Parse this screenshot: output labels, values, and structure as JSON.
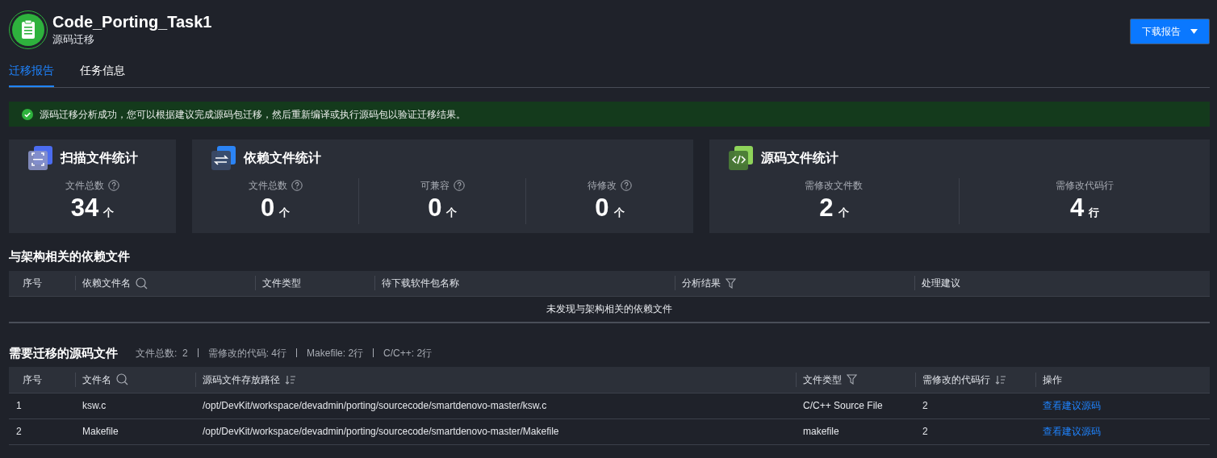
{
  "header": {
    "title": "Code_Porting_Task1",
    "subtitle": "源码迁移"
  },
  "download_button": {
    "label": "下载报告"
  },
  "tabs": [
    {
      "label": "迁移报告",
      "selected": true
    },
    {
      "label": "任务信息",
      "selected": false
    }
  ],
  "alert": {
    "message": "源码迁移分析成功，您可以根据建议完成源码包迁移，然后重新编译或执行源码包以验证迁移结果。"
  },
  "stat_cards": [
    {
      "kind": "scan",
      "title": "扫描文件统计",
      "metrics": [
        {
          "label": "文件总数",
          "help": true,
          "value": "34",
          "unit": "个"
        }
      ]
    },
    {
      "kind": "dependency",
      "title": "依赖文件统计",
      "metrics": [
        {
          "label": "文件总数",
          "help": true,
          "value": "0",
          "unit": "个"
        },
        {
          "label": "可兼容",
          "help": true,
          "value": "0",
          "unit": "个"
        },
        {
          "label": "待修改",
          "help": true,
          "value": "0",
          "unit": "个"
        }
      ]
    },
    {
      "kind": "source",
      "title": "源码文件统计",
      "metrics": [
        {
          "label": "需修改文件数",
          "help": false,
          "value": "2",
          "unit": "个"
        },
        {
          "label": "需修改代码行",
          "help": false,
          "value": "4",
          "unit": "行"
        }
      ]
    }
  ],
  "dependency_table": {
    "title": "与架构相关的依赖文件",
    "columns": [
      {
        "label": "序号",
        "kind": "plain"
      },
      {
        "label": "依赖文件名",
        "kind": "search"
      },
      {
        "label": "文件类型",
        "kind": "plain"
      },
      {
        "label": "待下载软件包名称",
        "kind": "plain"
      },
      {
        "label": "分析结果",
        "kind": "filter"
      },
      {
        "label": "处理建议",
        "kind": "plain"
      }
    ],
    "empty_text": "未发现与架构相关的依赖文件"
  },
  "source_table": {
    "title": "需要迁移的源码文件",
    "summary": [
      "文件总数:  2",
      "需修改的代码: 4行",
      "Makefile: 2行",
      "C/C++: 2行"
    ],
    "columns": [
      {
        "label": "序号",
        "kind": "plain"
      },
      {
        "label": "文件名",
        "kind": "search"
      },
      {
        "label": "源码文件存放路径",
        "kind": "sort"
      },
      {
        "label": "文件类型",
        "kind": "filter"
      },
      {
        "label": "需修改的代码行",
        "kind": "sort"
      },
      {
        "label": "操作",
        "kind": "plain"
      }
    ],
    "rows": [
      {
        "cells": [
          "1",
          "ksw.c",
          "/opt/DevKit/workspace/devadmin/porting/sourcecode/smartdenovo-master/ksw.c",
          "C/C++ Source File",
          "2"
        ],
        "action": "查看建议源码"
      },
      {
        "cells": [
          "2",
          "Makefile",
          "/opt/DevKit/workspace/devadmin/porting/sourcecode/smartdenovo-master/Makefile",
          "makefile",
          "2"
        ],
        "action": "查看建议源码"
      }
    ]
  }
}
